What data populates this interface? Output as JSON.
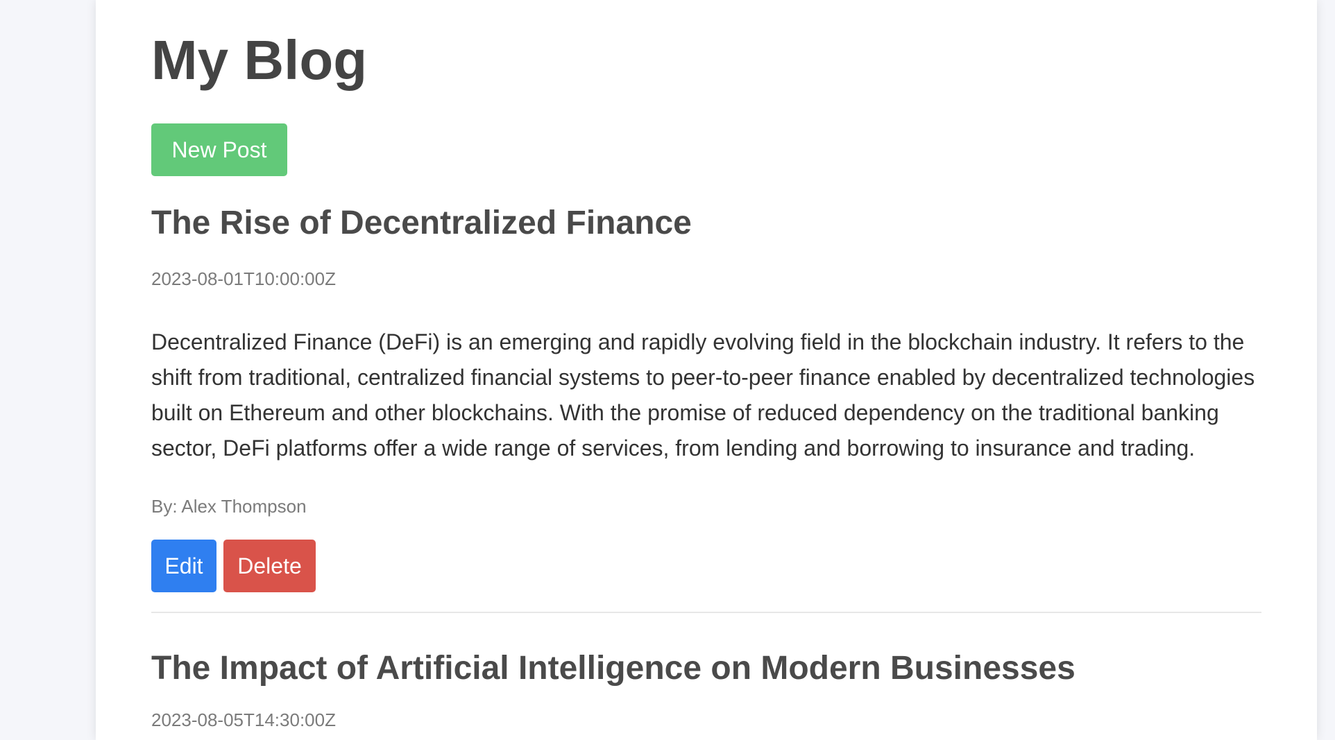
{
  "header": {
    "title": "My Blog",
    "new_post_label": "New Post"
  },
  "colors": {
    "new_post": "#62c979",
    "edit": "#2f7ff0",
    "delete": "#d9534a"
  },
  "posts": [
    {
      "title": "The Rise of Decentralized Finance",
      "date": "2023-08-01T10:00:00Z",
      "content": "Decentralized Finance (DeFi) is an emerging and rapidly evolving field in the blockchain industry. It refers to the shift from traditional, centralized financial systems to peer-to-peer finance enabled by decentralized technologies built on Ethereum and other blockchains. With the promise of reduced dependency on the traditional banking sector, DeFi platforms offer a wide range of services, from lending and borrowing to insurance and trading.",
      "author": "By: Alex Thompson",
      "edit_label": "Edit",
      "delete_label": "Delete"
    },
    {
      "title": "The Impact of Artificial Intelligence on Modern Businesses",
      "date": "2023-08-05T14:30:00Z"
    }
  ]
}
